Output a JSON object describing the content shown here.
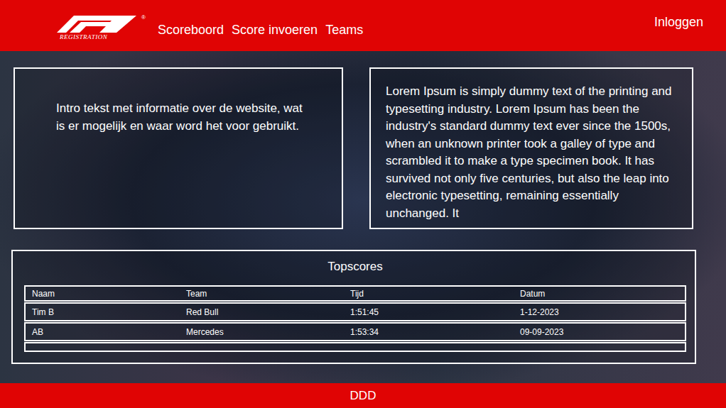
{
  "header": {
    "logo": {
      "caption": "REGISTRATION",
      "mark": "®"
    },
    "nav": [
      {
        "label": "Scoreboord"
      },
      {
        "label": "Score invoeren"
      },
      {
        "label": "Teams"
      }
    ],
    "login": "Inloggen"
  },
  "intro": {
    "text": "Intro tekst met informatie over de website, wat is er mogelijk en waar word het voor gebruikt."
  },
  "info": {
    "text": "Lorem Ipsum is simply dummy text of the printing and typesetting industry. Lorem Ipsum has been the industry's standard dummy text ever since the 1500s, when an unknown printer took a galley of type and scrambled it to make a type specimen book. It has survived not only five centuries, but also the leap into electronic typesetting, remaining essentially unchanged. It"
  },
  "topscores": {
    "title": "Topscores",
    "columns": [
      "Naam",
      "Team",
      "Tijd",
      "Datum"
    ],
    "rows": [
      {
        "cells": [
          "Tim B",
          "Red Bull",
          "1:51:45",
          "1-12-2023"
        ]
      },
      {
        "cells": [
          "AB",
          "Mercedes",
          "1:53:34",
          "09-09-2023"
        ]
      }
    ]
  },
  "footer": {
    "text": "DDD"
  }
}
